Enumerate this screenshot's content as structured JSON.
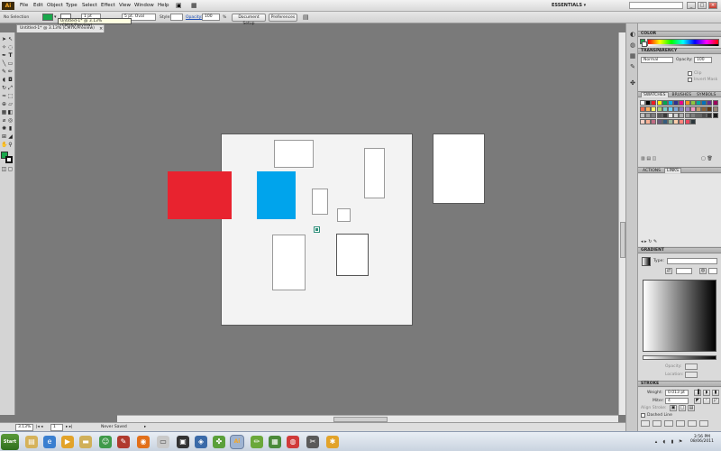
{
  "app": {
    "logo": "Ai",
    "menu": [
      "File",
      "Edit",
      "Object",
      "Type",
      "Select",
      "Effect",
      "View",
      "Window",
      "Help"
    ],
    "workspace": "ESSENTIALS ▾"
  },
  "control_bar": {
    "selection_status": "No Selection",
    "fill_color": "#1aa84c",
    "stroke_value": "1 pt",
    "brush": "5 pt. Oval",
    "style_label": "Style:",
    "opacity_label": "Opacity:",
    "opacity_value": "100",
    "opacity_unit": "%",
    "document_setup": "Document Setup",
    "preferences": "Preferences"
  },
  "tooltip": "Untitled-1* @ 3.13% (CMYK/Preview)",
  "document": {
    "tab_title": "Untitled-1* @ 3.13% (CMYK/Preview)",
    "close": "×"
  },
  "canvas": {
    "red_color": "#e8232f",
    "blue_color": "#00a4ec"
  },
  "status_bar": {
    "zoom": "3.13%",
    "page": "1",
    "status": "Never Saved"
  },
  "panels": {
    "color": {
      "title": "COLOR"
    },
    "transparency": {
      "title": "TRANSPARENCY",
      "mode": "Normal",
      "opacity_label": "Opacity:",
      "opacity_value": "100",
      "clip": "Clip",
      "invert_mask": "Invert Mask"
    },
    "swatches": {
      "tabs": [
        "SWATCHES",
        "BRUSHES",
        "SYMBOLS"
      ]
    },
    "actions": {
      "tabs": [
        "ACTIONS",
        "LINKS"
      ]
    },
    "gradient": {
      "title": "GRADIENT",
      "type_label": "Type:",
      "opacity_label": "Opacity:",
      "location_label": "Location:"
    },
    "stroke": {
      "title": "STROKE",
      "weight_label": "Weight:",
      "weight_value": "0.013 pt",
      "miter_label": "Miter:",
      "miter_value": "4",
      "align_label": "Align Stroke:",
      "dashed_line": "Dashed Line"
    }
  },
  "taskbar": {
    "start": "Start",
    "time": "3:56 PM",
    "date": "08/06/2011"
  }
}
